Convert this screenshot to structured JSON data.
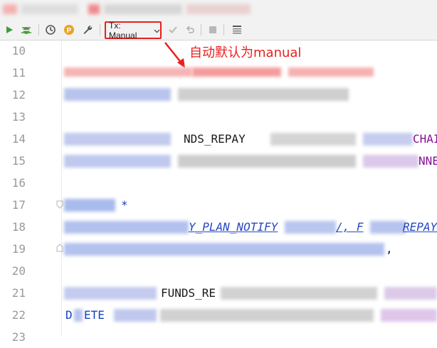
{
  "toolbar": {
    "tx_mode": "Tx: Manual",
    "icons": [
      "run-icon",
      "debug-icon",
      "history-icon",
      "profile-icon",
      "wrench-icon",
      "chevron-down-icon",
      "check-icon",
      "undo-icon",
      "stop-icon",
      "table-icon"
    ]
  },
  "annotation": {
    "text": "自动默认为manual"
  },
  "editor": {
    "line_numbers": [
      "10",
      "11",
      "12",
      "13",
      "14",
      "15",
      "16",
      "17",
      "18",
      "19",
      "20",
      "21",
      "22",
      "23"
    ],
    "visible_fragments": {
      "l14": "NDS_REPAY",
      "l14_right": "CHAI",
      "l15_right": "NNE",
      "l17": "*",
      "l18_mid": "Y_PLAN_NOTIFY",
      "l18_right": "/, F",
      "l18_tail": "REPAY",
      "l19_tail": ",",
      "l21_mid": "FUNDS_RE",
      "l22": "D",
      "l22_b": "ETE"
    }
  },
  "colors": {
    "accent_red": "#e8201e",
    "keyword_blue": "#1a3fbe",
    "purple": "#871094"
  }
}
